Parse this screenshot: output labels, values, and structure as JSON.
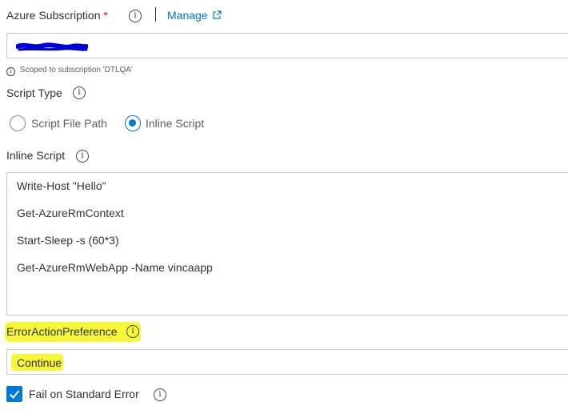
{
  "subscription": {
    "label": "Azure Subscription",
    "required_marker": "*",
    "manage_link": "Manage",
    "scoped_hint": "Scoped to subscription 'DTLQA'"
  },
  "script_type": {
    "label": "Script Type",
    "options": [
      "Script File Path",
      "Inline Script"
    ],
    "selected": "Inline Script"
  },
  "inline_script": {
    "label": "Inline Script",
    "lines": [
      "Write-Host \"Hello\"",
      "Get-AzureRmContext",
      "Start-Sleep -s (60*3)",
      "Get-AzureRmWebApp -Name vincaapp"
    ]
  },
  "error_action": {
    "label": "ErrorActionPreference",
    "value": "Continue"
  },
  "fail_on_stderr": {
    "label": "Fail on Standard Error",
    "checked": true
  },
  "icons": {
    "info": "info-icon",
    "external": "external-link-icon",
    "check": "checkmark-icon"
  },
  "colors": {
    "accent": "#0078d4",
    "highlight": "#f7f73a",
    "required": "#c50f1f"
  }
}
